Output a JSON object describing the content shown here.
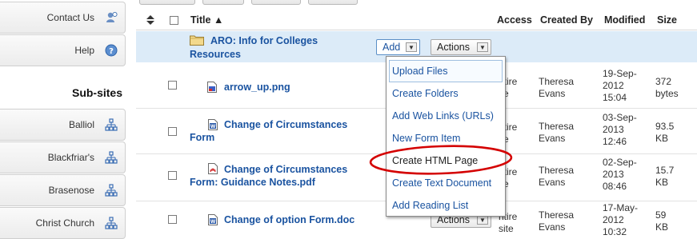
{
  "sidebar": {
    "items_top": [
      {
        "label": "Contact Us",
        "icon": "contact-icon"
      },
      {
        "label": "Help",
        "icon": "help-icon"
      }
    ],
    "subsites_heading": "Sub-sites",
    "subsites": [
      {
        "label": "Balliol",
        "icon": "sitemap-icon"
      },
      {
        "label": "Blackfriar's",
        "icon": "sitemap-icon"
      },
      {
        "label": "Brasenose",
        "icon": "sitemap-icon"
      },
      {
        "label": "Christ Church",
        "icon": "sitemap-icon"
      }
    ]
  },
  "table": {
    "headers": {
      "title": "Title ▲",
      "access": "Access",
      "created_by": "Created By",
      "modified": "Modified",
      "size": "Size"
    },
    "folder_row": {
      "title_line1": "ARO: Info for Colleges",
      "title_line2": "Resources",
      "add_label": "Add",
      "actions_label": "Actions"
    },
    "rows": [
      {
        "title_line1": "arrow_up.png",
        "title_line2": "",
        "access": "ntire",
        "access2": "ite",
        "created_by_1": "Theresa",
        "created_by_2": "Evans",
        "modified_1": "19-Sep-",
        "modified_2": "2012",
        "modified_3": "15:04",
        "size_1": "372",
        "size_2": "bytes",
        "icon": "png-file-icon"
      },
      {
        "title_line1": "Change of Circumstances",
        "title_line2": "Form",
        "access": "ntire",
        "access2": "ite",
        "created_by_1": "Theresa",
        "created_by_2": "Evans",
        "modified_1": "03-Sep-",
        "modified_2": "2013",
        "modified_3": "12:46",
        "size_1": "93.5",
        "size_2": "KB",
        "icon": "word-file-icon"
      },
      {
        "title_line1": "Change of Circumstances",
        "title_line2": "Form: Guidance Notes.pdf",
        "access": "ntire",
        "access2": "ite",
        "created_by_1": "Theresa",
        "created_by_2": "Evans",
        "modified_1": "02-Sep-",
        "modified_2": "2013",
        "modified_3": "08:46",
        "size_1": "15.7",
        "size_2": "KB",
        "icon": "pdf-file-icon"
      },
      {
        "title_line1": "Change of option Form.doc",
        "title_line2": "",
        "access": "ntire",
        "access2": "site",
        "created_by_1": "Theresa",
        "created_by_2": "Evans",
        "modified_1": "17-May-",
        "modified_2": "2012",
        "modified_3": "10:32",
        "size_1": "59",
        "size_2": "KB",
        "icon": "word-file-icon",
        "actions_label": "Actions"
      }
    ]
  },
  "add_menu": {
    "items": [
      "Upload Files",
      "Create Folders",
      "Add Web Links (URLs)",
      "New Form Item",
      "Create HTML Page",
      "Create Text Document",
      "Add Reading List"
    ]
  },
  "colors": {
    "link": "#1a53a0",
    "highlight_row": "#dcebf8",
    "annotation_circle": "#d40000"
  }
}
